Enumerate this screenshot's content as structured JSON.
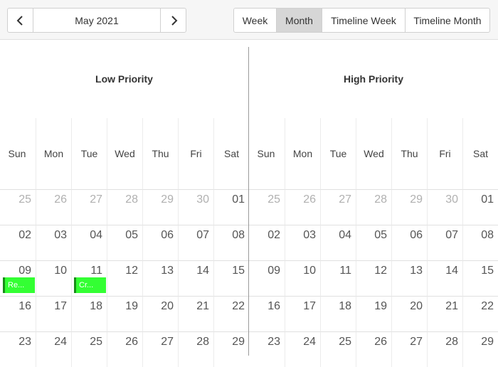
{
  "toolbar": {
    "date_label": "May 2021",
    "views": [
      "Week",
      "Month",
      "Timeline Week",
      "Timeline Month"
    ],
    "active_view": "Month"
  },
  "groups": [
    {
      "title": "Low Priority"
    },
    {
      "title": "High Priority"
    }
  ],
  "day_names": [
    "Sun",
    "Mon",
    "Tue",
    "Wed",
    "Thu",
    "Fri",
    "Sat"
  ],
  "weeks": [
    [
      {
        "d": "25",
        "o": true
      },
      {
        "d": "26",
        "o": true
      },
      {
        "d": "27",
        "o": true
      },
      {
        "d": "28",
        "o": true
      },
      {
        "d": "29",
        "o": true
      },
      {
        "d": "30",
        "o": true
      },
      {
        "d": "01",
        "o": false
      }
    ],
    [
      {
        "d": "02",
        "o": false
      },
      {
        "d": "03",
        "o": false
      },
      {
        "d": "04",
        "o": false
      },
      {
        "d": "05",
        "o": false
      },
      {
        "d": "06",
        "o": false
      },
      {
        "d": "07",
        "o": false
      },
      {
        "d": "08",
        "o": false
      }
    ],
    [
      {
        "d": "09",
        "o": false
      },
      {
        "d": "10",
        "o": false
      },
      {
        "d": "11",
        "o": false
      },
      {
        "d": "12",
        "o": false
      },
      {
        "d": "13",
        "o": false
      },
      {
        "d": "14",
        "o": false
      },
      {
        "d": "15",
        "o": false
      }
    ],
    [
      {
        "d": "16",
        "o": false
      },
      {
        "d": "17",
        "o": false
      },
      {
        "d": "18",
        "o": false
      },
      {
        "d": "19",
        "o": false
      },
      {
        "d": "20",
        "o": false
      },
      {
        "d": "21",
        "o": false
      },
      {
        "d": "22",
        "o": false
      }
    ],
    [
      {
        "d": "23",
        "o": false
      },
      {
        "d": "24",
        "o": false
      },
      {
        "d": "25",
        "o": false
      },
      {
        "d": "26",
        "o": false
      },
      {
        "d": "27",
        "o": false
      },
      {
        "d": "28",
        "o": false
      },
      {
        "d": "29",
        "o": false
      }
    ]
  ],
  "events": [
    {
      "label": "Re...",
      "group": 0,
      "week": 2,
      "day": 0,
      "color": "#33ff33"
    },
    {
      "label": "Cr...",
      "group": 0,
      "week": 2,
      "day": 2,
      "color": "#33ff33"
    }
  ]
}
